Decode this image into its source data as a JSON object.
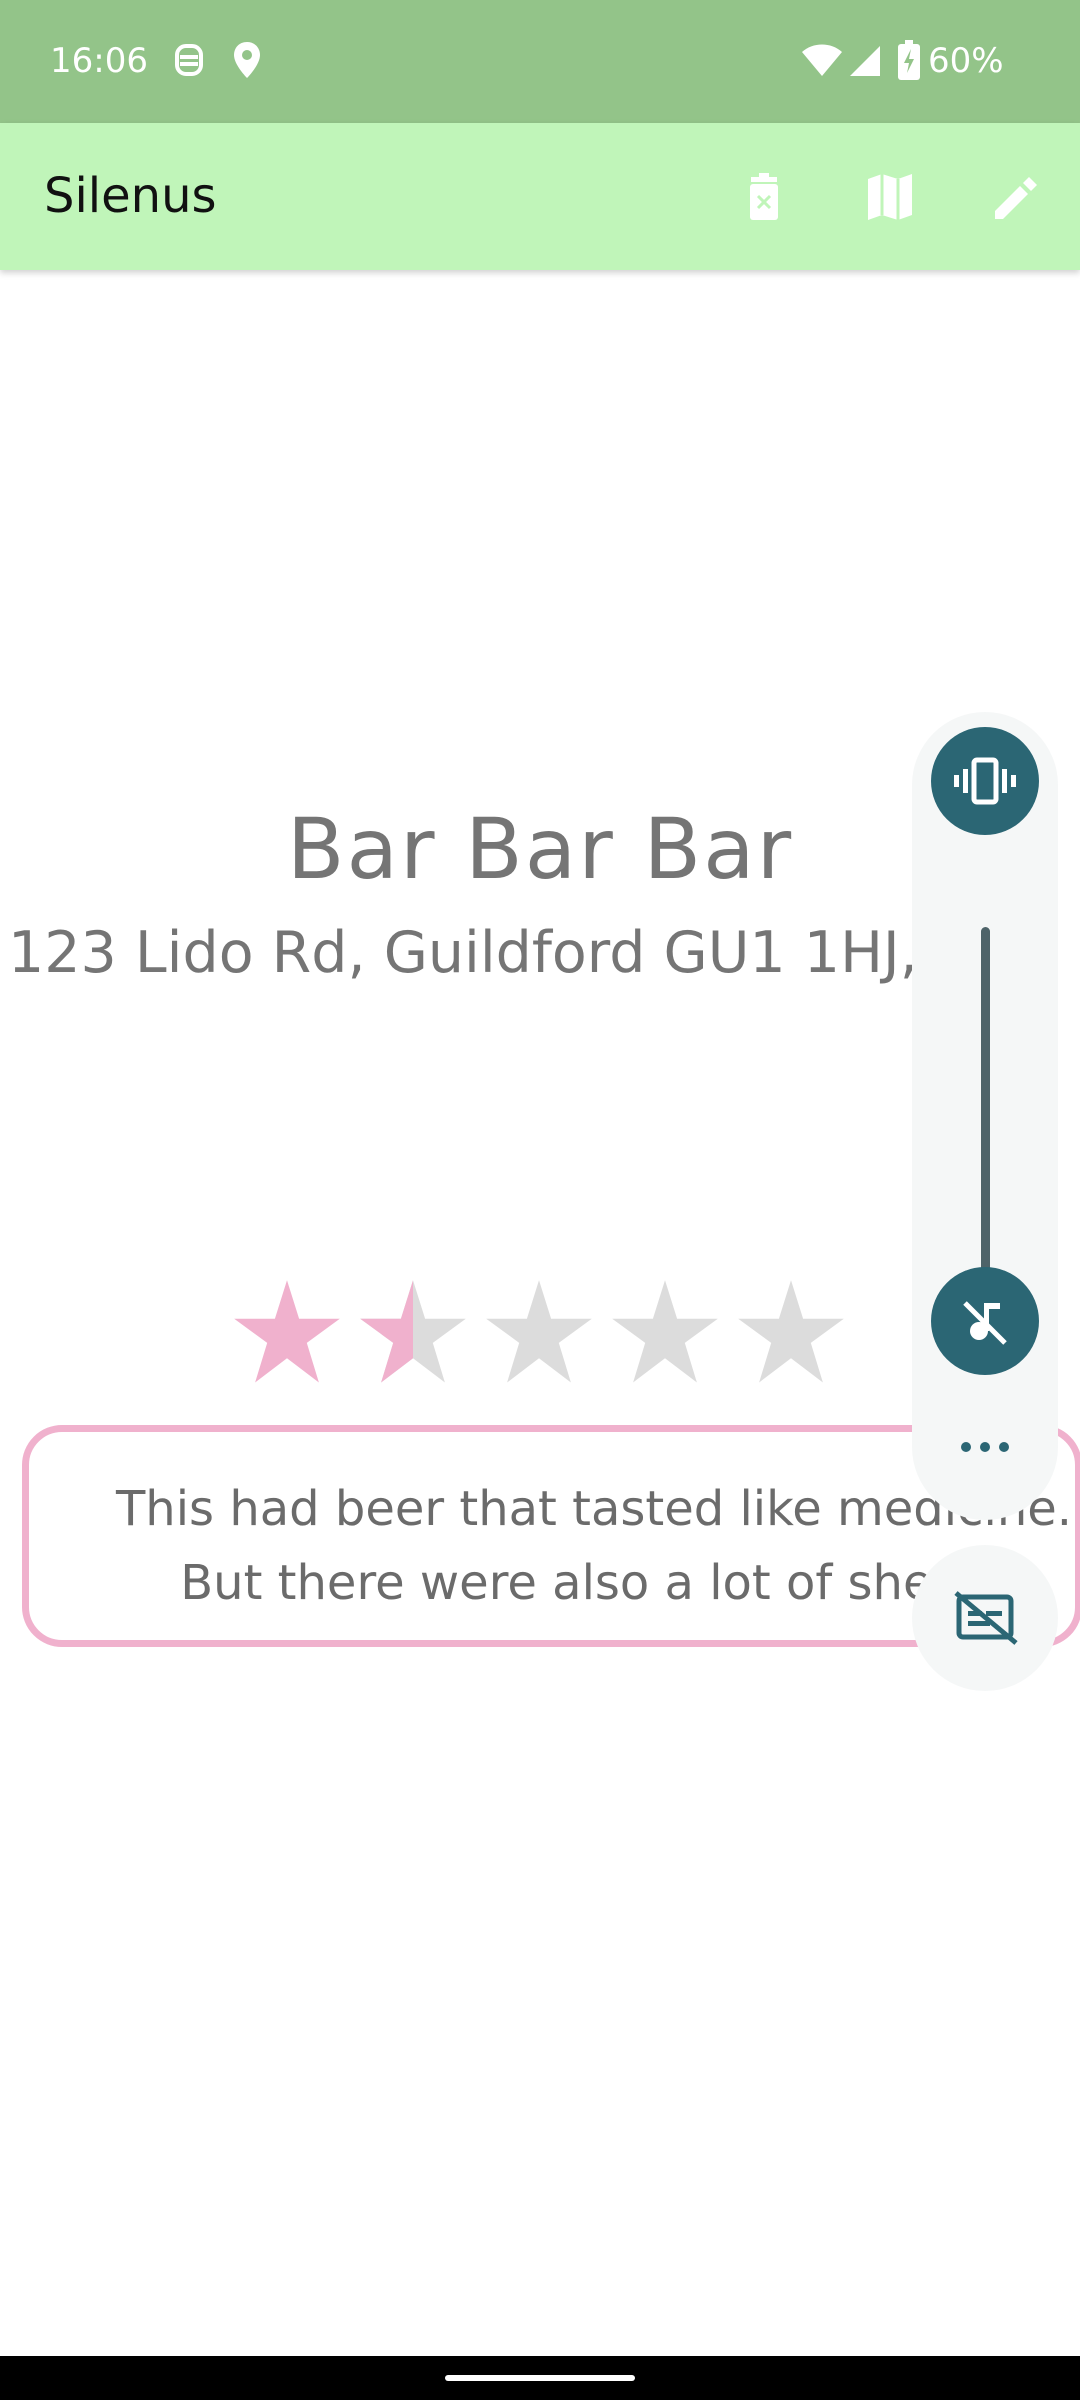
{
  "status_bar": {
    "time": "16:06",
    "battery_text": "60%",
    "icons": [
      "no-disturb-face-icon",
      "location-pin-icon",
      "wifi-icon",
      "cell-signal-icon",
      "battery-charging-icon"
    ]
  },
  "app_bar": {
    "title": "Silenus",
    "actions": [
      "delete-icon",
      "map-icon",
      "edit-icon"
    ],
    "background": "#c0f5b9"
  },
  "venue": {
    "name": "Bar Bar Bar",
    "address": "123 Lido Rd, Guildford GU1 1HJ, UK",
    "rating": 1.5,
    "rating_max": 5,
    "review_line1": "This had beer that tasted like medicine.",
    "review_line2": "But there were also a lot of sheep."
  },
  "volume_panel": {
    "level": 0,
    "icons": [
      "vibrate-icon",
      "music-muted-icon",
      "more-dots-icon",
      "captions-off-icon"
    ]
  },
  "colors": {
    "star_filled": "#f0b1cd",
    "star_empty": "#dcdcdc",
    "accent": "#2b6674",
    "status_bar": "#93c489"
  }
}
